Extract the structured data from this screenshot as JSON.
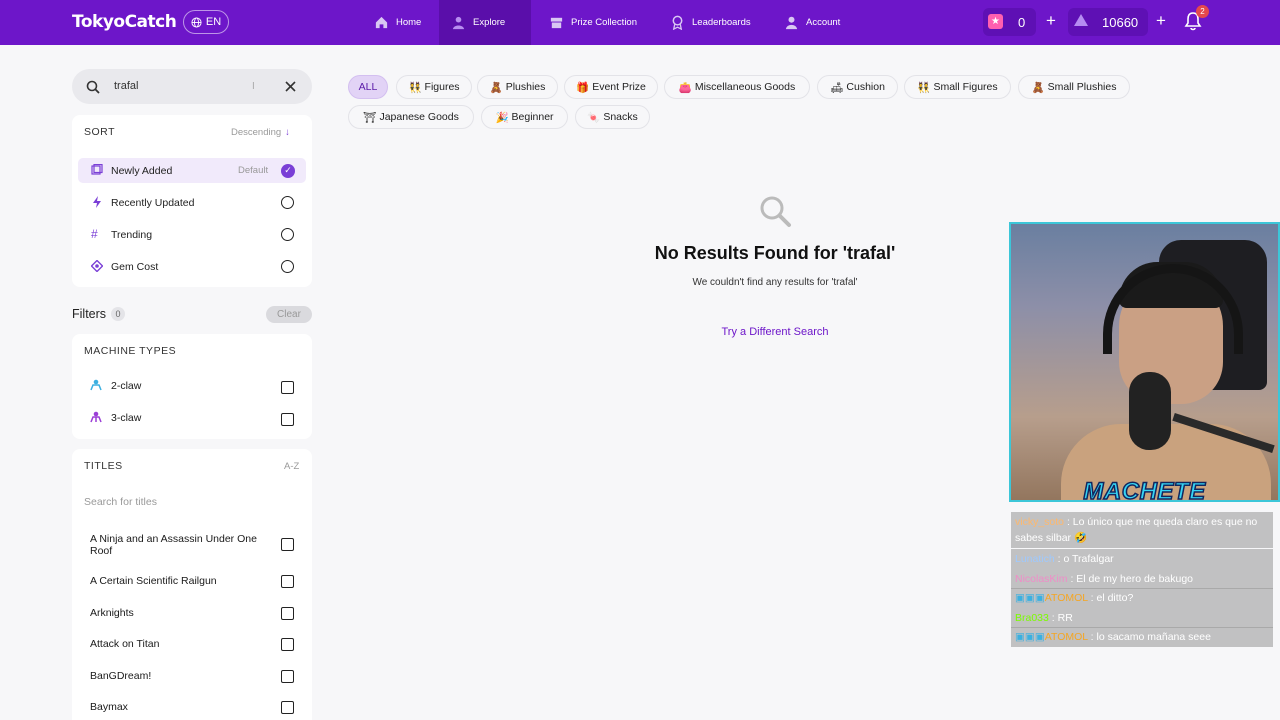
{
  "header": {
    "logo": "TokyoCatch",
    "lang": "EN",
    "nav": [
      {
        "label": "Home"
      },
      {
        "label": "Explore"
      },
      {
        "label": "Prize Collection"
      },
      {
        "label": "Leaderboards"
      },
      {
        "label": "Account"
      }
    ],
    "tickets": "0",
    "gems": "10660",
    "notifications": "2"
  },
  "search": {
    "value": "trafal"
  },
  "sort": {
    "title": "SORT",
    "direction": "Descending",
    "default_label": "Default",
    "options": [
      {
        "label": "Newly Added",
        "selected": true
      },
      {
        "label": "Recently Updated",
        "selected": false
      },
      {
        "label": "Trending",
        "selected": false
      },
      {
        "label": "Gem Cost",
        "selected": false
      }
    ]
  },
  "filters": {
    "title": "Filters",
    "count": "0",
    "clear": "Clear"
  },
  "machine_types": {
    "title": "MACHINE TYPES",
    "items": [
      {
        "label": "2-claw"
      },
      {
        "label": "3-claw"
      }
    ]
  },
  "titles": {
    "title": "TITLES",
    "order": "A-Z",
    "placeholder": "Search for titles",
    "items": [
      {
        "label": "A Ninja and an Assassin Under One Roof"
      },
      {
        "label": "A Certain Scientific Railgun"
      },
      {
        "label": "Arknights"
      },
      {
        "label": "Attack on Titan"
      },
      {
        "label": "BanGDream!"
      },
      {
        "label": "Baymax"
      }
    ]
  },
  "categories": [
    {
      "label": "ALL",
      "emoji": ""
    },
    {
      "label": "Figures",
      "emoji": "👯"
    },
    {
      "label": "Plushies",
      "emoji": "🧸"
    },
    {
      "label": "Event Prize",
      "emoji": "🎁"
    },
    {
      "label": "Miscellaneous Goods",
      "emoji": "👛"
    },
    {
      "label": "Cushion",
      "emoji": "🛋"
    },
    {
      "label": "Small Figures",
      "emoji": "👯"
    },
    {
      "label": "Small Plushies",
      "emoji": "🧸"
    },
    {
      "label": "Japanese Goods",
      "emoji": "⛩"
    },
    {
      "label": "Beginner",
      "emoji": "🎉"
    },
    {
      "label": "Snacks",
      "emoji": "🍬"
    }
  ],
  "results": {
    "heading": "No Results Found for 'trafal'",
    "subtext": "We couldn't find any results for 'trafal'",
    "action": "Try a Different Search"
  },
  "stream": {
    "name": "MACHETE",
    "chat": [
      {
        "user": "vicky_soto",
        "msg": ": Lo único que me queda claro es que no sabes silbar 🤣",
        "color": "#ffb86b"
      },
      {
        "user": "Lunatich",
        "msg": ": o Trafalgar",
        "color": "#9ec9ff"
      },
      {
        "user": "NicolasKim",
        "msg": ": El de my hero de bakugo",
        "color": "#f08cc8"
      },
      {
        "user": "ATOMOL",
        "msg": ": el ditto?",
        "color": "#f5a623"
      },
      {
        "user": "Bra033",
        "msg": ": RR",
        "color": "#7cfc00"
      },
      {
        "user": "ATOMOL",
        "msg": ": lo sacamo mañana seee",
        "color": "#f5a623"
      }
    ]
  }
}
